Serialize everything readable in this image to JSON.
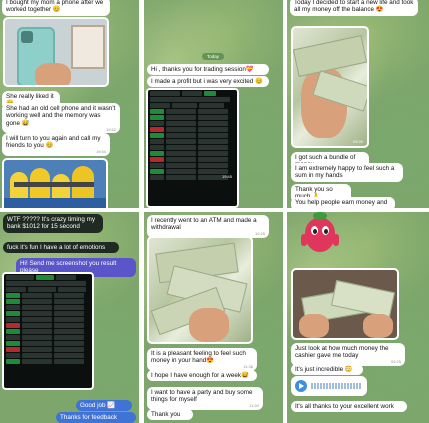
{
  "panels": {
    "p1": {
      "msg1": "I bought my mom a phone after we worked together 😊",
      "msg2": "She really liked it 😊",
      "msg3": "She had an old cell phone and it wasn't working well and the memory was gone 😅",
      "msg4": "I will turn to you again and call my friends to you 😊",
      "t2": "19:51",
      "t3": "19:52",
      "t4": "19:54"
    },
    "p2": {
      "chip": "Today",
      "msg1": "Hi , thanks you for trading session💝",
      "msg2": "I made a profit but i was very excited 😊",
      "t1": "19:53",
      "t2": "19:53",
      "t3": "19:45"
    },
    "p3": {
      "msg1": "Today I decided to start a new life and took all my money off the balance 😍",
      "msg2": "I got such a bundle of money",
      "msg3": "I am extremely happy to feel such a sum in my hands",
      "msg4": "Thank you so much 🙏",
      "msg5": "You help people earn money and",
      "t1": "09:20",
      "t2": "09:28",
      "t3": "09:29",
      "t4": "09:29",
      "t5": "09:30"
    },
    "p4": {
      "msg1": "WTF ????? It's crazy timing my bank $1012 for 15 second",
      "msg2": "fuck it's fun I have a lot of emotions",
      "msg3": "Hi! Send me screenshot you result please",
      "msg4": "Good job 📈",
      "msg5": "Thanks for feedback",
      "t1": "16:58",
      "t2": "16:58",
      "t3": "16:59",
      "t4": "16:59",
      "t5": "16:59"
    },
    "p5": {
      "msg1": "I recently went to an ATM and made a withdrawal",
      "msg2": "It is a pleasant feeling to feel such money in your hand😍",
      "msg3": "I hope I have enough for a week😅",
      "msg4": "I want to have a party and buy some things for myself",
      "msg5": "Thank you",
      "t1": "10:25",
      "t2": "11:38",
      "t3": "11:40",
      "t4": "11:40",
      "t5": "11:41"
    },
    "p6": {
      "msg1": "Just look at how much money the cashier gave me today",
      "msg2": "It's just incredible 😳",
      "voice": "",
      "msg3": "It's all thanks to your excellent work",
      "t1": "09:25",
      "t2": "09:25",
      "t3": "09:26"
    }
  },
  "colors": {
    "bubble_in": "#ffffff",
    "bubble_out": "#e2fcc6",
    "wallpaper": "#7da56c"
  }
}
